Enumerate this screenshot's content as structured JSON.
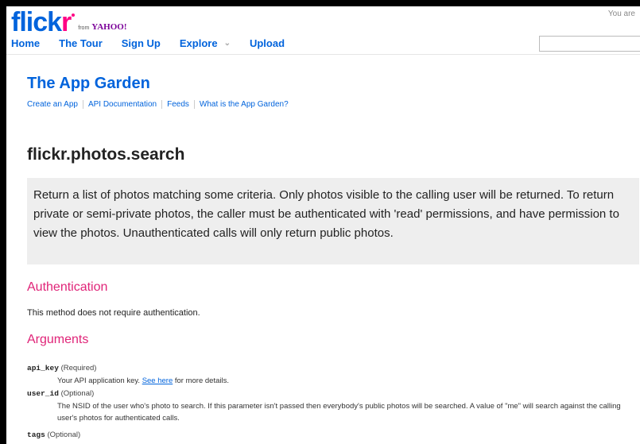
{
  "header": {
    "logo_main": "flick",
    "logo_r": "r",
    "logo_from": "from",
    "logo_yahoo": "YAHOO!",
    "you_are": "You are",
    "nav": [
      "Home",
      "The Tour",
      "Sign Up",
      "Explore",
      "Upload"
    ],
    "search_value": ""
  },
  "garden": {
    "title": "The App Garden",
    "links": [
      "Create an App",
      "API Documentation",
      "Feeds",
      "What is the App Garden?"
    ]
  },
  "method": {
    "name": "flickr.photos.search",
    "description": "Return a list of photos matching some criteria. Only photos visible to the calling user will be returned. To return private or semi-private photos, the caller must be authenticated with 'read' permissions, and have permission to view the photos. Unauthenticated calls will only return public photos."
  },
  "authentication": {
    "heading": "Authentication",
    "text": "This method does not require authentication."
  },
  "arguments": {
    "heading": "Arguments",
    "items": [
      {
        "name": "api_key",
        "flag": "(Required)",
        "desc_before": "Your API application key. ",
        "desc_link": "See here",
        "desc_after": " for more details."
      },
      {
        "name": "user_id",
        "flag": "(Optional)",
        "desc": "The NSID of the user who's photo to search. If this parameter isn't passed then everybody's public photos will be searched. A value of \"me\" will search against the calling user's photos for authenticated calls."
      },
      {
        "name": "tags",
        "flag": "(Optional)"
      }
    ]
  }
}
